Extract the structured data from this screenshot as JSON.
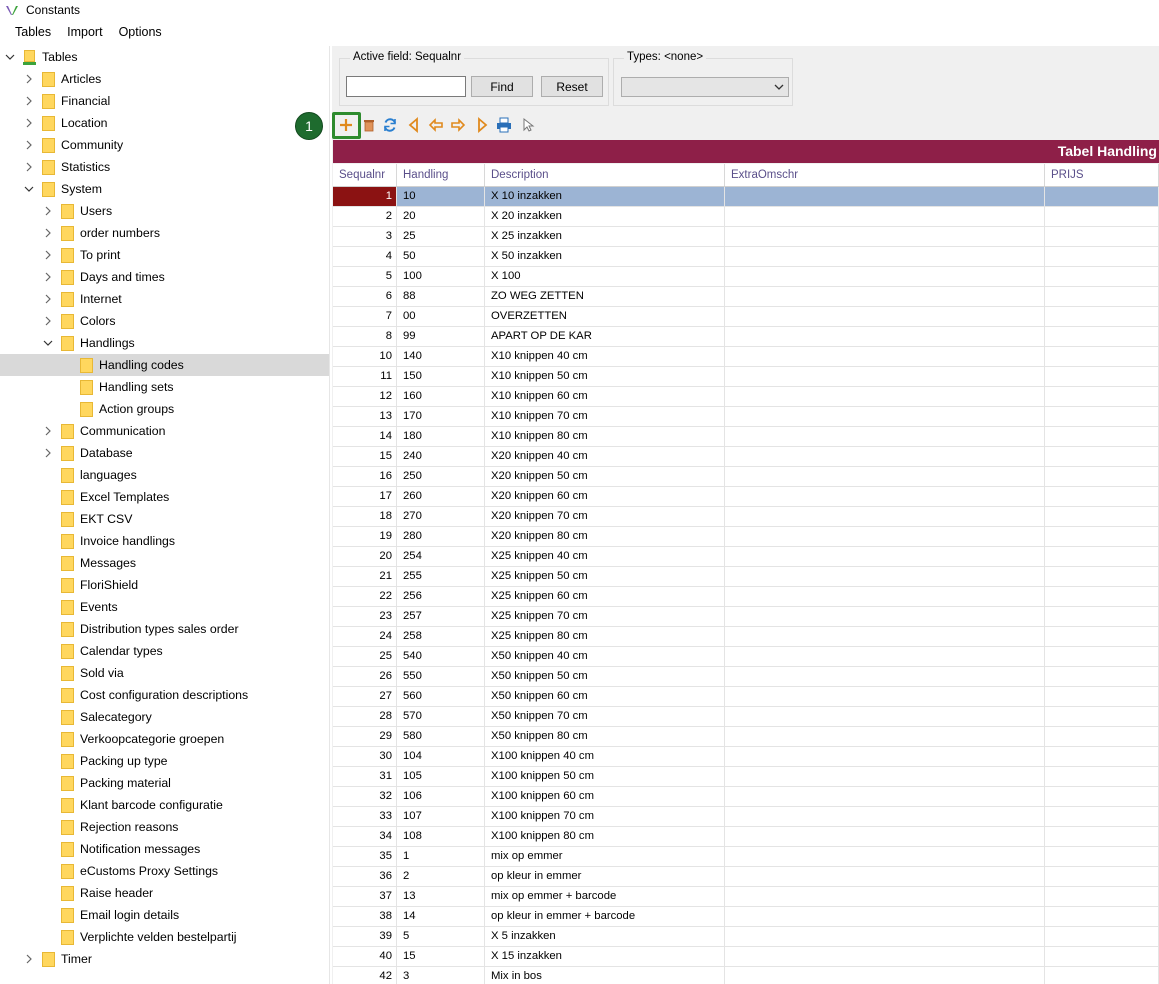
{
  "window": {
    "title": "Constants"
  },
  "menu": [
    "Tables",
    "Import",
    "Options"
  ],
  "tree": [
    {
      "label": "Tables",
      "level": 0,
      "chevron": "down",
      "root": true
    },
    {
      "label": "Articles",
      "level": 1,
      "chevron": "right"
    },
    {
      "label": "Financial",
      "level": 1,
      "chevron": "right"
    },
    {
      "label": "Location",
      "level": 1,
      "chevron": "right"
    },
    {
      "label": "Community",
      "level": 1,
      "chevron": "right"
    },
    {
      "label": "Statistics",
      "level": 1,
      "chevron": "right"
    },
    {
      "label": "System",
      "level": 1,
      "chevron": "down"
    },
    {
      "label": "Users",
      "level": 2,
      "chevron": "right"
    },
    {
      "label": "order numbers",
      "level": 2,
      "chevron": "right"
    },
    {
      "label": "To print",
      "level": 2,
      "chevron": "right"
    },
    {
      "label": "Days and times",
      "level": 2,
      "chevron": "right"
    },
    {
      "label": "Internet",
      "level": 2,
      "chevron": "right"
    },
    {
      "label": "Colors",
      "level": 2,
      "chevron": "right"
    },
    {
      "label": "Handlings",
      "level": 2,
      "chevron": "down"
    },
    {
      "label": "Handling codes",
      "level": 3,
      "chevron": "none",
      "selected": true
    },
    {
      "label": "Handling sets",
      "level": 3,
      "chevron": "none"
    },
    {
      "label": "Action groups",
      "level": 3,
      "chevron": "none"
    },
    {
      "label": "Communication",
      "level": 2,
      "chevron": "right"
    },
    {
      "label": "Database",
      "level": 2,
      "chevron": "right"
    },
    {
      "label": "languages",
      "level": 2,
      "chevron": "none"
    },
    {
      "label": "Excel Templates",
      "level": 2,
      "chevron": "none"
    },
    {
      "label": "EKT CSV",
      "level": 2,
      "chevron": "none"
    },
    {
      "label": "Invoice handlings",
      "level": 2,
      "chevron": "none"
    },
    {
      "label": "Messages",
      "level": 2,
      "chevron": "none"
    },
    {
      "label": "FloriShield",
      "level": 2,
      "chevron": "none"
    },
    {
      "label": "Events",
      "level": 2,
      "chevron": "none"
    },
    {
      "label": "Distribution types sales order",
      "level": 2,
      "chevron": "none"
    },
    {
      "label": "Calendar types",
      "level": 2,
      "chevron": "none"
    },
    {
      "label": "Sold via",
      "level": 2,
      "chevron": "none"
    },
    {
      "label": "Cost configuration descriptions",
      "level": 2,
      "chevron": "none"
    },
    {
      "label": "Salecategory",
      "level": 2,
      "chevron": "none"
    },
    {
      "label": "Verkoopcategorie groepen",
      "level": 2,
      "chevron": "none"
    },
    {
      "label": "Packing up type",
      "level": 2,
      "chevron": "none"
    },
    {
      "label": "Packing material",
      "level": 2,
      "chevron": "none"
    },
    {
      "label": "Klant barcode configuratie",
      "level": 2,
      "chevron": "none"
    },
    {
      "label": "Rejection reasons",
      "level": 2,
      "chevron": "none"
    },
    {
      "label": "Notification messages",
      "level": 2,
      "chevron": "none"
    },
    {
      "label": "eCustoms Proxy Settings",
      "level": 2,
      "chevron": "none"
    },
    {
      "label": "Raise header",
      "level": 2,
      "chevron": "none"
    },
    {
      "label": "Email login details",
      "level": 2,
      "chevron": "none"
    },
    {
      "label": "Verplichte velden bestelpartij",
      "level": 2,
      "chevron": "none"
    },
    {
      "label": "Timer",
      "level": 1,
      "chevron": "right"
    }
  ],
  "search": {
    "legend": "Active field: Sequalnr",
    "value": "",
    "find_label": "Find",
    "reset_label": "Reset"
  },
  "types": {
    "legend": "Types: <none>",
    "value": ""
  },
  "toolbar": {
    "step_badge": "1",
    "icons": [
      "add-icon",
      "delete-icon",
      "refresh-icon",
      "first-icon",
      "previous-icon",
      "next-icon",
      "last-icon",
      "print-icon",
      "pointer-icon"
    ]
  },
  "table": {
    "title": "Tabel Handling",
    "columns": [
      "Sequalnr",
      "Handling",
      "Description",
      "ExtraOmschr",
      "PRIJS"
    ],
    "rows": [
      [
        "1",
        "10",
        "X 10 inzakken",
        "",
        ""
      ],
      [
        "2",
        "20",
        "X 20 inzakken",
        "",
        ""
      ],
      [
        "3",
        "25",
        "X 25 inzakken",
        "",
        ""
      ],
      [
        "4",
        "50",
        "X 50 inzakken",
        "",
        ""
      ],
      [
        "5",
        "100",
        "X 100",
        "",
        ""
      ],
      [
        "6",
        "88",
        "ZO WEG ZETTEN",
        "",
        ""
      ],
      [
        "7",
        "00",
        "OVERZETTEN",
        "",
        ""
      ],
      [
        "8",
        "99",
        "APART OP DE KAR",
        "",
        ""
      ],
      [
        "10",
        "140",
        "X10 knippen 40 cm",
        "",
        ""
      ],
      [
        "11",
        "150",
        "X10 knippen 50 cm",
        "",
        ""
      ],
      [
        "12",
        "160",
        "X10 knippen 60 cm",
        "",
        ""
      ],
      [
        "13",
        "170",
        "X10 knippen 70 cm",
        "",
        ""
      ],
      [
        "14",
        "180",
        "X10 knippen 80 cm",
        "",
        ""
      ],
      [
        "15",
        "240",
        "X20 knippen 40 cm",
        "",
        ""
      ],
      [
        "16",
        "250",
        "X20 knippen 50 cm",
        "",
        ""
      ],
      [
        "17",
        "260",
        "X20 knippen 60 cm",
        "",
        ""
      ],
      [
        "18",
        "270",
        "X20 knippen 70 cm",
        "",
        ""
      ],
      [
        "19",
        "280",
        "X20 knippen 80 cm",
        "",
        ""
      ],
      [
        "20",
        "254",
        "X25 knippen 40 cm",
        "",
        ""
      ],
      [
        "21",
        "255",
        "X25 knippen 50 cm",
        "",
        ""
      ],
      [
        "22",
        "256",
        "X25 knippen 60 cm",
        "",
        ""
      ],
      [
        "23",
        "257",
        "X25 knippen 70 cm",
        "",
        ""
      ],
      [
        "24",
        "258",
        "X25 knippen 80 cm",
        "",
        ""
      ],
      [
        "25",
        "540",
        "X50 knippen 40 cm",
        "",
        ""
      ],
      [
        "26",
        "550",
        "X50 knippen 50 cm",
        "",
        ""
      ],
      [
        "27",
        "560",
        "X50 knippen 60 cm",
        "",
        ""
      ],
      [
        "28",
        "570",
        "X50 knippen 70 cm",
        "",
        ""
      ],
      [
        "29",
        "580",
        "X50 knippen 80 cm",
        "",
        ""
      ],
      [
        "30",
        "104",
        "X100 knippen 40 cm",
        "",
        ""
      ],
      [
        "31",
        "105",
        "X100 knippen 50 cm",
        "",
        ""
      ],
      [
        "32",
        "106",
        "X100 knippen 60 cm",
        "",
        ""
      ],
      [
        "33",
        "107",
        "X100 knippen 70 cm",
        "",
        ""
      ],
      [
        "34",
        "108",
        "X100 knippen 80 cm",
        "",
        ""
      ],
      [
        "35",
        "1",
        "mix op emmer",
        "",
        ""
      ],
      [
        "36",
        "2",
        "op kleur in emmer",
        "",
        ""
      ],
      [
        "37",
        "13",
        "mix op emmer + barcode",
        "",
        ""
      ],
      [
        "38",
        "14",
        "op kleur in emmer + barcode",
        "",
        ""
      ],
      [
        "39",
        "5",
        "X 5 inzakken",
        "",
        ""
      ],
      [
        "40",
        "15",
        "X 15 inzakken",
        "",
        ""
      ],
      [
        "42",
        "3",
        "Mix in bos",
        "",
        ""
      ]
    ],
    "selected_row": 0
  },
  "colors": {
    "title_bar": "#8e1f48",
    "selected_row": "#9cb4d4",
    "selected_seq": "#8b1212",
    "highlight": "#2e8b2e"
  }
}
